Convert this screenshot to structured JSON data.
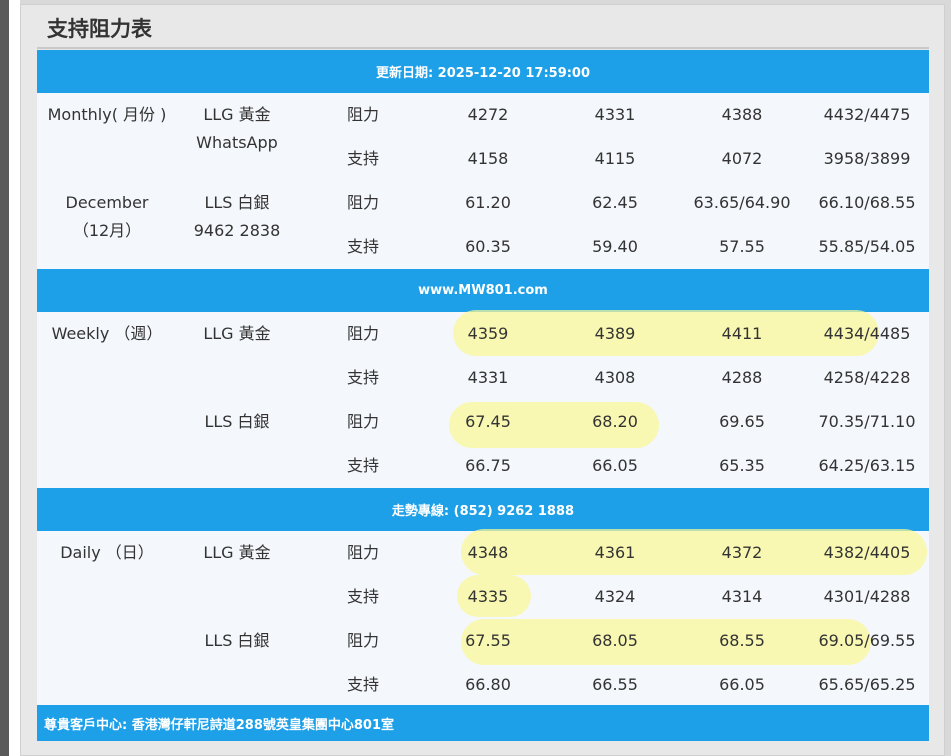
{
  "title": "支持阻力表",
  "banners": {
    "updated": "更新日期: 2025-12-20 17:59:00",
    "website": "www.MW801.com",
    "hotline": "走勢專線: (852) 9262 1888",
    "address": "尊貴客戶中心: 香港灣仔軒尼詩道288號英皇集團中心801室"
  },
  "monthly": {
    "period_label": "Monthly( 月份 )",
    "month_en": "December",
    "month_zh": "（12月）",
    "gold_label": "LLG 黃金",
    "gold_sub": "WhatsApp",
    "silver_label": "LLS 白銀",
    "silver_sub": "9462 2838",
    "rows": [
      {
        "type": "阻力",
        "v": [
          "4272",
          "4331",
          "4388",
          "4432/4475"
        ]
      },
      {
        "type": "支持",
        "v": [
          "4158",
          "4115",
          "4072",
          "3958/3899"
        ]
      },
      {
        "type": "阻力",
        "v": [
          "61.20",
          "62.45",
          "63.65/64.90",
          "66.10/68.55"
        ]
      },
      {
        "type": "支持",
        "v": [
          "60.35",
          "59.40",
          "57.55",
          "55.85/54.05"
        ]
      }
    ]
  },
  "weekly": {
    "period_label": "Weekly （週）",
    "gold_label": "LLG 黃金",
    "silver_label": "LLS 白銀",
    "rows": [
      {
        "type": "阻力",
        "v": [
          "4359",
          "4389",
          "4411",
          "4434/4485"
        ]
      },
      {
        "type": "支持",
        "v": [
          "4331",
          "4308",
          "4288",
          "4258/4228"
        ]
      },
      {
        "type": "阻力",
        "v": [
          "67.45",
          "68.20",
          "69.65",
          "70.35/71.10"
        ]
      },
      {
        "type": "支持",
        "v": [
          "66.75",
          "66.05",
          "65.35",
          "64.25/63.15"
        ]
      }
    ]
  },
  "daily": {
    "period_label": "Daily （日）",
    "gold_label": "LLG 黃金",
    "silver_label": "LLS 白銀",
    "rows": [
      {
        "type": "阻力",
        "v": [
          "4348",
          "4361",
          "4372",
          "4382/4405"
        ]
      },
      {
        "type": "支持",
        "v": [
          "4335",
          "4324",
          "4314",
          "4301/4288"
        ]
      },
      {
        "type": "阻力",
        "v": [
          "67.55",
          "68.05",
          "68.55",
          "69.05/69.55"
        ]
      },
      {
        "type": "支持",
        "v": [
          "66.80",
          "66.55",
          "66.05",
          "65.65/65.25"
        ]
      }
    ]
  },
  "colors": {
    "banner": "#1da0e8",
    "row_bg": "#f4f7fb",
    "highlight": "#faf896"
  }
}
